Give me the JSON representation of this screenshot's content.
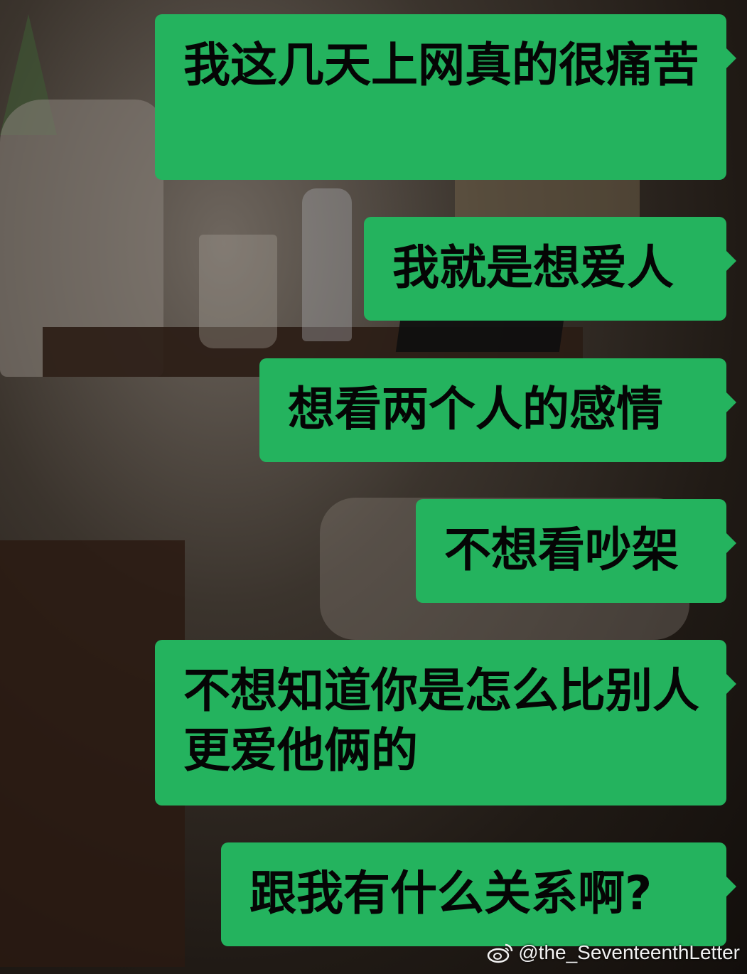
{
  "messages": [
    {
      "text": "我这几天上网真的很痛苦"
    },
    {
      "text": "我就是想爱人"
    },
    {
      "text": "想看两个人的感情"
    },
    {
      "text": "不想看吵架"
    },
    {
      "text": "不想知道你是怎么比别人更爱他俩的"
    },
    {
      "text": "跟我有什么关系啊?"
    }
  ],
  "watermark": {
    "icon": "weibo-icon",
    "text": "@the_SeventeenthLetter"
  },
  "colors": {
    "bubble": "#24b35e",
    "text": "#050505"
  }
}
